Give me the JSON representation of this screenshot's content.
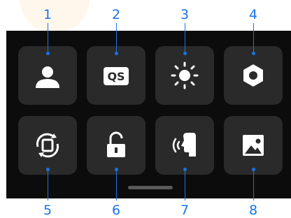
{
  "callouts": {
    "c1": "1",
    "c2": "2",
    "c3": "3",
    "c4": "4",
    "c5": "5",
    "c6": "6",
    "c7": "7",
    "c8": "8"
  },
  "tiles": {
    "quick_settings_label": "QS"
  },
  "colors": {
    "callout": "#1a73e8",
    "panel": "#0c0c0c",
    "tile": "#2a2a2a",
    "icon": "#ffffff"
  },
  "icons": [
    "user-icon",
    "quick-settings-icon",
    "brightness-icon",
    "hexagon-icon",
    "rotate-screen-icon",
    "unlock-icon",
    "voice-control-icon",
    "image-icon"
  ]
}
